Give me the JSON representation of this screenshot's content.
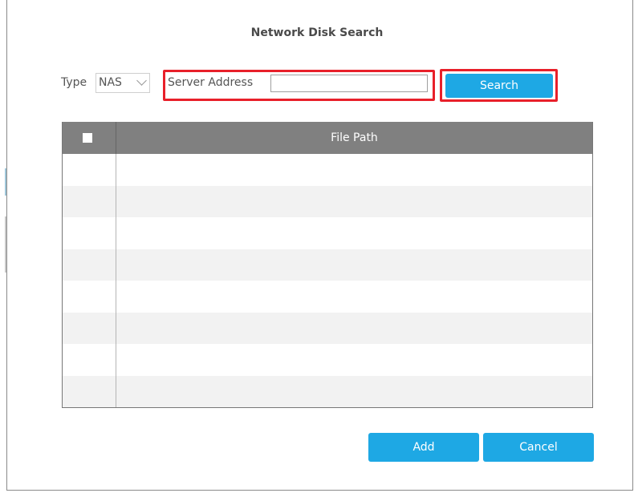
{
  "dialog": {
    "title": "Network Disk Search"
  },
  "form": {
    "type_label": "Type",
    "type_value": "NAS",
    "server_address_label": "Server Address",
    "server_address_value": "",
    "search_label": "Search"
  },
  "table": {
    "columns": [
      "File Path"
    ],
    "rows": []
  },
  "footer": {
    "add_label": "Add",
    "cancel_label": "Cancel"
  },
  "colors": {
    "accent": "#1ea8e4",
    "highlight": "#e8202a",
    "header_bg": "#808080"
  }
}
